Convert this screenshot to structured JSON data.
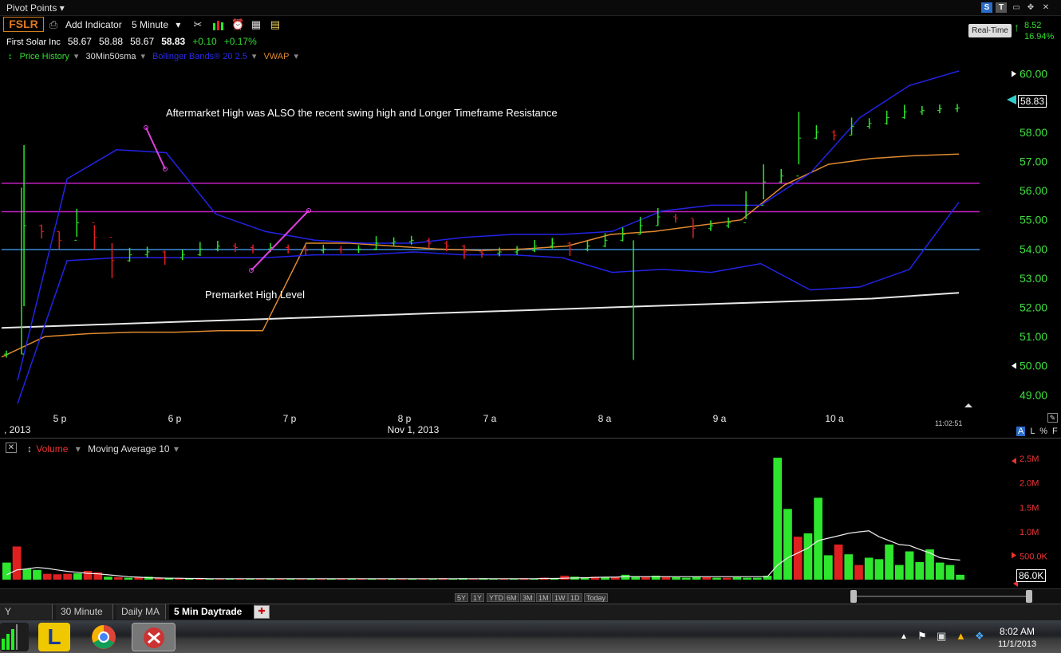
{
  "window": {
    "title": "Pivot Points",
    "title_arrow": "▾",
    "s_badge": "S",
    "t_badge": "T"
  },
  "toolbar": {
    "symbol": "FSLR",
    "add_indicator": "Add Indicator",
    "interval": "5 Minute",
    "interval_arrow": "▾"
  },
  "quote": {
    "name": "First Solar Inc",
    "open": "58.67",
    "high": "58.88",
    "low": "58.67",
    "last": "58.83",
    "change": "+0.10",
    "change_pct": "+0.17%"
  },
  "indicators": {
    "price_history": "Price History",
    "sma": "30Min50sma",
    "bollinger": "Bollinger Bands® 20 2.5",
    "vwap": "VWAP"
  },
  "realtime": {
    "label": "Real-Time",
    "value": "8.52",
    "pct": "16.94%"
  },
  "colors": {
    "up": "#2ee62e",
    "down": "#e02020",
    "bollinger": "#2323e8",
    "vwap": "#e08a30",
    "sma": "#e8e8e8",
    "resistance": "#c020c0",
    "premarket": "#3a8ad8",
    "axis_text": "#3ee03e"
  },
  "chart_data": [
    {
      "type": "line",
      "title": "",
      "ylim": [
        48.6,
        60.4
      ],
      "ytick_labels": [
        "60.00",
        "59.00",
        "58.00",
        "57.00",
        "56.00",
        "55.00",
        "54.00",
        "53.00",
        "52.00",
        "51.00",
        "50.00",
        "49.00"
      ],
      "yticks": [
        60,
        59,
        58,
        57,
        56,
        55,
        54,
        53,
        52,
        51,
        50,
        49
      ],
      "time_labels": [
        "5 p",
        "6 p",
        "7 p",
        "8 p",
        "7 a",
        "8 a",
        "9 a",
        "10 a"
      ],
      "date_labels": [
        ", 2013",
        "Nov 1, 2013"
      ],
      "timestamp": "11:02:51",
      "last_price_label": "58.83",
      "horizontal_levels": [
        {
          "value": 56.25,
          "color": "#c020c0"
        },
        {
          "value": 55.28,
          "color": "#c020c0"
        },
        {
          "value": 53.98,
          "color": "#3a8ad8"
        }
      ],
      "annotations": [
        "Aftermarket High was ALSO the recent swing high and Longer Timeframe Resistance",
        "Premarket High Level"
      ],
      "series": [
        {
          "key": "price",
          "values": [
            50.4,
            54.8,
            54.6,
            54.3,
            54.9,
            54.4,
            53.6,
            53.8,
            53.9,
            53.7,
            53.8,
            54.0,
            54.1,
            54.05,
            54.0,
            54.05,
            54.0,
            53.95,
            54.0,
            53.98,
            54.0,
            54.2,
            54.25,
            54.3,
            54.2,
            54.1,
            53.9,
            53.85,
            53.9,
            53.95,
            54.1,
            54.2,
            54.0,
            54.1,
            54.3,
            54.5,
            54.8,
            55.1,
            55.05,
            54.7,
            54.8,
            54.9,
            55.5,
            56.3,
            56.5,
            57.8,
            58.0,
            57.9,
            58.2,
            58.3,
            58.5,
            58.7,
            58.75,
            58.8,
            58.83
          ]
        },
        {
          "key": "sma",
          "values": [
            51.3,
            51.4,
            51.5,
            51.6,
            51.7,
            51.8,
            51.9,
            52.0,
            52.1,
            52.2,
            52.3,
            52.5
          ]
        },
        {
          "key": "vwap",
          "values": [
            50.3,
            51.0,
            51.1,
            51.15,
            51.15,
            51.2,
            51.2,
            54.2,
            54.2,
            54.1,
            54.0,
            53.95,
            54.0,
            54.1,
            54.5,
            54.6,
            54.8,
            55.0,
            56.2,
            56.9,
            57.1,
            57.2,
            57.25
          ]
        },
        {
          "key": "bb_upper",
          "values": [
            49.5,
            56.4,
            57.4,
            57.3,
            55.2,
            54.6,
            54.3,
            54.2,
            54.2,
            54.4,
            54.5,
            54.5,
            54.6,
            55.3,
            55.5,
            55.5,
            56.6,
            58.5,
            59.6,
            60.1
          ]
        },
        {
          "key": "bb_lower",
          "values": [
            48.7,
            53.6,
            53.7,
            53.7,
            53.7,
            53.7,
            53.8,
            53.8,
            53.9,
            53.8,
            53.8,
            53.7,
            53.2,
            53.3,
            53.2,
            53.5,
            52.6,
            52.7,
            53.3,
            55.6
          ]
        }
      ]
    },
    {
      "type": "bar",
      "title": "",
      "series_name": "Volume",
      "overlay_name": "Moving Average 10",
      "ylim": [
        0,
        2.6
      ],
      "ytick_labels": [
        "2.5M",
        "2.0M",
        "1.5M",
        "1.0M",
        "500.0K"
      ],
      "yticks": [
        2.5,
        2.0,
        1.5,
        1.0,
        0.5
      ],
      "last_volume_label": "86.0K",
      "values_m": [
        0.35,
        0.68,
        0.22,
        0.2,
        0.12,
        0.11,
        0.12,
        0.13,
        0.18,
        0.15,
        0.06,
        0.05,
        0.04,
        0.05,
        0.06,
        0.04,
        0.04,
        0.03,
        0.03,
        0.03,
        0.02,
        0.02,
        0.02,
        0.02,
        0.02,
        0.02,
        0.02,
        0.02,
        0.02,
        0.02,
        0.02,
        0.02,
        0.02,
        0.02,
        0.02,
        0.02,
        0.02,
        0.02,
        0.02,
        0.02,
        0.02,
        0.02,
        0.02,
        0.03,
        0.02,
        0.03,
        0.02,
        0.03,
        0.02,
        0.02,
        0.02,
        0.03,
        0.02,
        0.04,
        0.03,
        0.08,
        0.06,
        0.05,
        0.06,
        0.05,
        0.06,
        0.1,
        0.07,
        0.06,
        0.08,
        0.06,
        0.05,
        0.04,
        0.06,
        0.05,
        0.04,
        0.04,
        0.05,
        0.04,
        0.04,
        0.08,
        2.5,
        1.45,
        0.88,
        0.95,
        1.68,
        0.5,
        0.72,
        0.52,
        0.3,
        0.45,
        0.42,
        0.72,
        0.3,
        0.58,
        0.36,
        0.62,
        0.35,
        0.3,
        0.1
      ],
      "directions": "UDUUDDDUDDUDUDUDUDUDUDUDUDUDUDUDUDUDUDUDUDUDUUDUUDUDUDUDUUDUDUUDUDUUUDUDUUUUUUDUUUDUDUUUUUUUUUU",
      "ma_m": [
        0.1,
        0.2,
        0.22,
        0.25,
        0.23,
        0.2,
        0.17,
        0.15,
        0.13,
        0.12,
        0.1,
        0.08,
        0.06,
        0.05,
        0.04,
        0.035,
        0.03,
        0.03,
        0.025,
        0.025,
        0.02,
        0.02,
        0.02,
        0.02,
        0.02,
        0.02,
        0.02,
        0.02,
        0.02,
        0.02,
        0.02,
        0.02,
        0.02,
        0.02,
        0.02,
        0.02,
        0.02,
        0.02,
        0.02,
        0.02,
        0.02,
        0.02,
        0.02,
        0.02,
        0.02,
        0.02,
        0.02,
        0.02,
        0.02,
        0.02,
        0.02,
        0.02,
        0.02,
        0.025,
        0.025,
        0.03,
        0.035,
        0.04,
        0.045,
        0.05,
        0.05,
        0.06,
        0.06,
        0.06,
        0.06,
        0.06,
        0.06,
        0.06,
        0.06,
        0.06,
        0.06,
        0.06,
        0.06,
        0.06,
        0.06,
        0.06,
        0.3,
        0.45,
        0.55,
        0.65,
        0.8,
        0.85,
        0.9,
        0.95,
        0.98,
        1.0,
        0.88,
        0.8,
        0.72,
        0.7,
        0.62,
        0.55,
        0.45,
        0.42,
        0.4
      ]
    }
  ],
  "scale_options": {
    "a": "A",
    "l": "L",
    "pct": "%",
    "f": "F"
  },
  "range_buttons": [
    "5Y",
    "1Y",
    "YTD",
    "6M",
    "3M",
    "1M",
    "1W",
    "1D",
    "Today"
  ],
  "tabs": [
    "Y Volatility",
    "30 Minute",
    "Daily MA",
    "5 Min Daytrade"
  ],
  "clock": {
    "time": "8:02 AM",
    "date": "11/1/2013"
  }
}
